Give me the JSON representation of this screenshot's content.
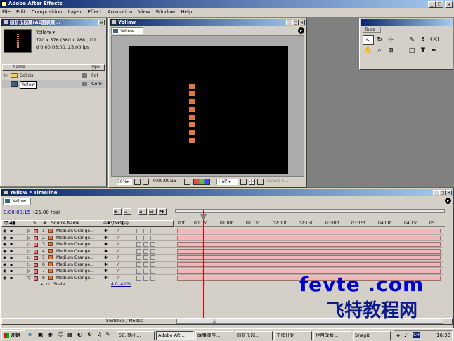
{
  "app": {
    "title": "Adobe After Effects"
  },
  "menu": [
    "File",
    "Edit",
    "Composition",
    "Layer",
    "Effect",
    "Animation",
    "View",
    "Window",
    "Help"
  ],
  "project": {
    "tab_title": "随音乐起舞(AE图表录...",
    "comp_name": "Yellow ▾",
    "comp_size": "720 x 576  (360 x 288), D1",
    "comp_duration": "d 0:00:05:00, 25.00 fps",
    "col_name": "Name",
    "col_type": "Type",
    "items": [
      {
        "name": "Solids",
        "type": "Fol"
      },
      {
        "name": "Yellow",
        "type": "Com"
      }
    ]
  },
  "comp_window": {
    "title": "Yellow",
    "tab": "Yellow",
    "zoom": "50%",
    "timecode": "0:00:00:15",
    "resolution": "Half",
    "camera": "Active C..."
  },
  "tools": {
    "title": "Tools"
  },
  "timeline": {
    "title": "Yellow * Timeline",
    "tab": "Yellow",
    "timecode": "0:00:00:15",
    "fps": "(25.00 fps)",
    "col_source": "Source Name",
    "switches_label": "Switches / Modes",
    "ruler": [
      "00f",
      "00:15f",
      "01:00f",
      "01:15f",
      "02:00f",
      "02:15f",
      "03:00f",
      "03:15f",
      "04:00f",
      "04:15f",
      "05"
    ],
    "layers": [
      {
        "num": "1",
        "name": "Medium Orange..."
      },
      {
        "num": "2",
        "name": "Medium Orange..."
      },
      {
        "num": "3",
        "name": "Medium Orange..."
      },
      {
        "num": "4",
        "name": "Medium Orange..."
      },
      {
        "num": "5",
        "name": "Medium Orange..."
      },
      {
        "num": "6",
        "name": "Medium Orange..."
      },
      {
        "num": "7",
        "name": "Medium Orange..."
      },
      {
        "num": "8",
        "name": "Medium Orange..."
      }
    ],
    "scale_label": "Scale",
    "scale_value": "4.0, 4.0%"
  },
  "watermark": {
    "line1": "fevte .com",
    "line2": "飞特教程网"
  },
  "taskbar": {
    "start": "开始",
    "items": [
      "50. 随小...",
      "Adobe Aft...",
      "故事顺序...",
      "随音乐起...",
      "工作计划",
      "栏目改版...",
      "SnagIt"
    ],
    "lang": "CH",
    "clock": "16:33"
  },
  "colors": {
    "accent": "#e07840",
    "bar": "#f0b8b8",
    "title": "#0a246a"
  }
}
